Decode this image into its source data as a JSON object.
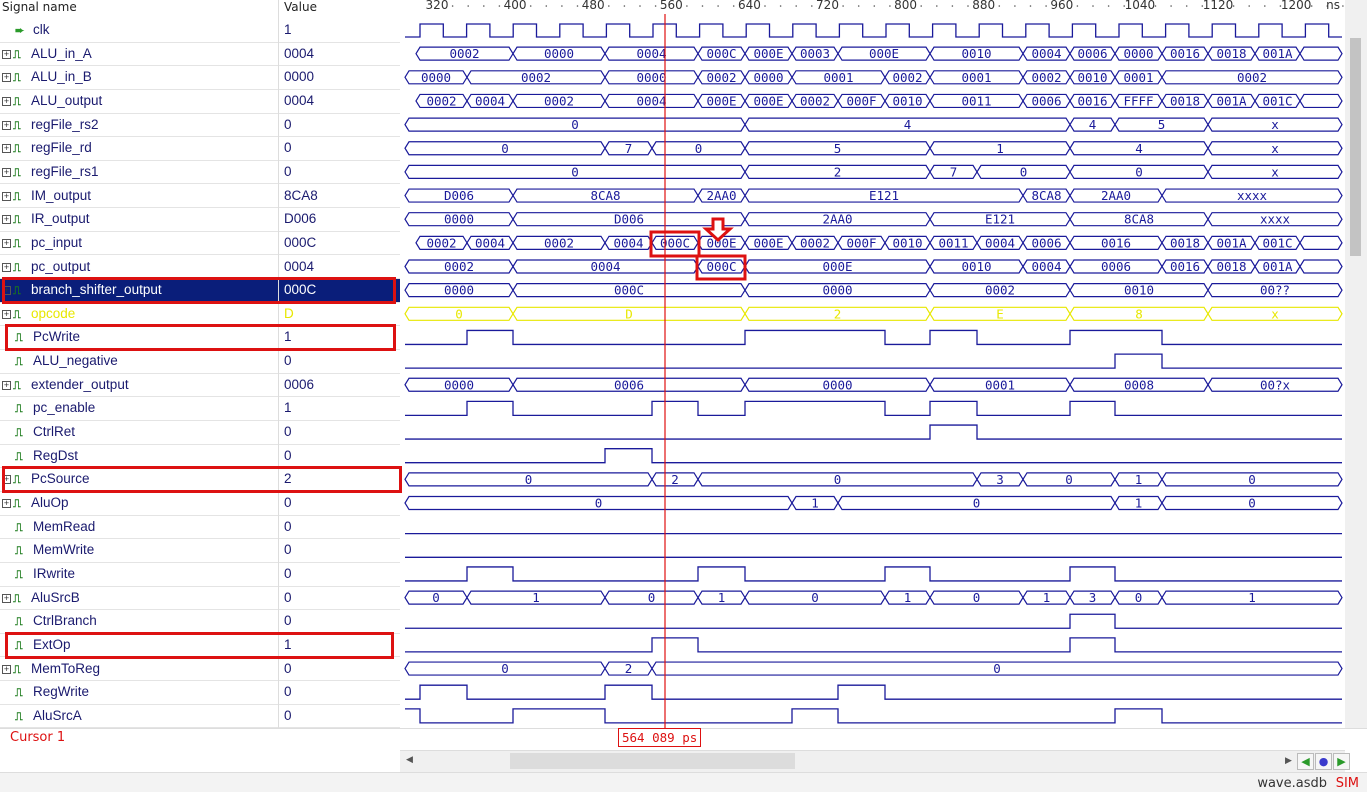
{
  "header": {
    "signal_name": "Signal name",
    "value": "Value",
    "unit": "ns",
    "ticks": [
      "320",
      "400",
      "480",
      "560",
      "640",
      "720",
      "800",
      "880",
      "960",
      "1040",
      "1120",
      "1200"
    ]
  },
  "signals": [
    {
      "name": "clk",
      "value": "1",
      "expand": false,
      "icon": "clock-arrow-icon"
    },
    {
      "name": "ALU_in_A",
      "value": "0004",
      "expand": true
    },
    {
      "name": "ALU_in_B",
      "value": "0000",
      "expand": true
    },
    {
      "name": "ALU_output",
      "value": "0004",
      "expand": true
    },
    {
      "name": "regFile_rs2",
      "value": "0",
      "expand": true
    },
    {
      "name": "regFile_rd",
      "value": "0",
      "expand": true
    },
    {
      "name": "regFile_rs1",
      "value": "0",
      "expand": true
    },
    {
      "name": "IM_output",
      "value": "8CA8",
      "expand": true
    },
    {
      "name": "IR_output",
      "value": "D006",
      "expand": true
    },
    {
      "name": "pc_input",
      "value": "000C",
      "expand": true
    },
    {
      "name": "pc_output",
      "value": "0004",
      "expand": true
    },
    {
      "name": "branch_shifter_output",
      "value": "000C",
      "expand": true,
      "selected": true
    },
    {
      "name": "opcode",
      "value": "D",
      "expand": true,
      "yellow": true
    },
    {
      "name": "PcWrite",
      "value": "1",
      "expand": false
    },
    {
      "name": "ALU_negative",
      "value": "0",
      "expand": false
    },
    {
      "name": "extender_output",
      "value": "0006",
      "expand": true
    },
    {
      "name": "pc_enable",
      "value": "1",
      "expand": false
    },
    {
      "name": "CtrlRet",
      "value": "0",
      "expand": false
    },
    {
      "name": "RegDst",
      "value": "0",
      "expand": false
    },
    {
      "name": "PcSource",
      "value": "2",
      "expand": true
    },
    {
      "name": "AluOp",
      "value": "0",
      "expand": true
    },
    {
      "name": "MemRead",
      "value": "0",
      "expand": false
    },
    {
      "name": "MemWrite",
      "value": "0",
      "expand": false
    },
    {
      "name": "IRwrite",
      "value": "0",
      "expand": false
    },
    {
      "name": "AluSrcB",
      "value": "0",
      "expand": true
    },
    {
      "name": "CtrlBranch",
      "value": "0",
      "expand": false
    },
    {
      "name": "ExtOp",
      "value": "1",
      "expand": false
    },
    {
      "name": "MemToReg",
      "value": "0",
      "expand": true
    },
    {
      "name": "RegWrite",
      "value": "0",
      "expand": false
    },
    {
      "name": "AluSrcA",
      "value": "0",
      "expand": false
    }
  ],
  "waves": {
    "ALU_in_A": [
      [
        "0002",
        416,
        513
      ],
      [
        "0000",
        513,
        605
      ],
      [
        "0004",
        605,
        698
      ],
      [
        "000C",
        698,
        745
      ],
      [
        "000E",
        745,
        792
      ],
      [
        "0003",
        792,
        838
      ],
      [
        "000E",
        838,
        930
      ],
      [
        "0010",
        930,
        1023
      ],
      [
        "0004",
        1023,
        1070
      ],
      [
        "0006",
        1070,
        1115
      ],
      [
        "0000",
        1115,
        1162
      ],
      [
        "0016",
        1162,
        1208
      ],
      [
        "0018",
        1208,
        1255
      ],
      [
        "001A",
        1255,
        1300
      ],
      [
        "",
        1300,
        1342
      ]
    ],
    "ALU_in_B": [
      [
        "0000",
        405,
        467
      ],
      [
        "0002",
        467,
        605
      ],
      [
        "0000",
        605,
        698
      ],
      [
        "0002",
        698,
        745
      ],
      [
        "0000",
        745,
        792
      ],
      [
        "0001",
        792,
        885
      ],
      [
        "0002",
        885,
        930
      ],
      [
        "0001",
        930,
        1023
      ],
      [
        "0002",
        1023,
        1070
      ],
      [
        "0010",
        1070,
        1115
      ],
      [
        "0001",
        1115,
        1162
      ],
      [
        "0002",
        1162,
        1342
      ]
    ],
    "ALU_output": [
      [
        "0002",
        416,
        467
      ],
      [
        "0004",
        467,
        513
      ],
      [
        "0002",
        513,
        605
      ],
      [
        "0004",
        605,
        698
      ],
      [
        "000E",
        698,
        745
      ],
      [
        "000E",
        745,
        792
      ],
      [
        "0002",
        792,
        838
      ],
      [
        "000F",
        838,
        885
      ],
      [
        "0010",
        885,
        930
      ],
      [
        "0011",
        930,
        1023
      ],
      [
        "0006",
        1023,
        1070
      ],
      [
        "0016",
        1070,
        1115
      ],
      [
        "FFFF",
        1115,
        1162
      ],
      [
        "0018",
        1162,
        1208
      ],
      [
        "001A",
        1208,
        1255
      ],
      [
        "001C",
        1255,
        1300
      ],
      [
        "",
        1300,
        1342
      ]
    ],
    "regFile_rs2": [
      [
        "0",
        405,
        745
      ],
      [
        "4",
        745,
        1070
      ],
      [
        "4",
        1070,
        1115
      ],
      [
        "5",
        1115,
        1208
      ],
      [
        "x",
        1208,
        1342
      ]
    ],
    "regFile_rd": [
      [
        "0",
        405,
        605
      ],
      [
        "7",
        605,
        652
      ],
      [
        "0",
        652,
        745
      ],
      [
        "5",
        745,
        930
      ],
      [
        "1",
        930,
        1070
      ],
      [
        "4",
        1070,
        1208
      ],
      [
        "x",
        1208,
        1342
      ]
    ],
    "regFile_rs1": [
      [
        "0",
        405,
        745
      ],
      [
        "2",
        745,
        930
      ],
      [
        "7",
        930,
        977
      ],
      [
        "0",
        977,
        1070
      ],
      [
        "0",
        1070,
        1208
      ],
      [
        "x",
        1208,
        1342
      ]
    ],
    "IM_output": [
      [
        "D006",
        405,
        513
      ],
      [
        "8CA8",
        513,
        698
      ],
      [
        "2AA0",
        698,
        745
      ],
      [
        "E121",
        745,
        1023
      ],
      [
        "8CA8",
        1023,
        1070
      ],
      [
        "2AA0",
        1070,
        1162
      ],
      [
        "xxxx",
        1162,
        1342
      ]
    ],
    "IR_output": [
      [
        "0000",
        405,
        513
      ],
      [
        "D006",
        513,
        745
      ],
      [
        "2AA0",
        745,
        930
      ],
      [
        "E121",
        930,
        1070
      ],
      [
        "8CA8",
        1070,
        1208
      ],
      [
        "xxxx",
        1208,
        1342
      ]
    ],
    "pc_input": [
      [
        "0002",
        416,
        467
      ],
      [
        "0004",
        467,
        513
      ],
      [
        "0002",
        513,
        605
      ],
      [
        "0004",
        605,
        652
      ],
      [
        "000C",
        652,
        698
      ],
      [
        "000E",
        698,
        745
      ],
      [
        "000E",
        745,
        792
      ],
      [
        "0002",
        792,
        838
      ],
      [
        "000F",
        838,
        885
      ],
      [
        "0010",
        885,
        930
      ],
      [
        "0011",
        930,
        977
      ],
      [
        "0004",
        977,
        1023
      ],
      [
        "0006",
        1023,
        1070
      ],
      [
        "0016",
        1070,
        1162
      ],
      [
        "0018",
        1162,
        1208
      ],
      [
        "001A",
        1208,
        1255
      ],
      [
        "001C",
        1255,
        1300
      ],
      [
        "",
        1300,
        1342
      ]
    ],
    "pc_output": [
      [
        "0002",
        405,
        513
      ],
      [
        "0004",
        513,
        698
      ],
      [
        "000C",
        698,
        745
      ],
      [
        "000E",
        745,
        930
      ],
      [
        "0010",
        930,
        1023
      ],
      [
        "0004",
        1023,
        1070
      ],
      [
        "0006",
        1070,
        1162
      ],
      [
        "0016",
        1162,
        1208
      ],
      [
        "0018",
        1208,
        1255
      ],
      [
        "001A",
        1255,
        1300
      ],
      [
        "",
        1300,
        1342
      ]
    ],
    "branch_shifter_output": [
      [
        "0000",
        405,
        513
      ],
      [
        "000C",
        513,
        745
      ],
      [
        "0000",
        745,
        930
      ],
      [
        "0002",
        930,
        1070
      ],
      [
        "0010",
        1070,
        1208
      ],
      [
        "00??",
        1208,
        1342
      ]
    ],
    "opcode": [
      [
        "0",
        405,
        513
      ],
      [
        "D",
        513,
        745
      ],
      [
        "2",
        745,
        930
      ],
      [
        "E",
        930,
        1070
      ],
      [
        "8",
        1070,
        1208
      ],
      [
        "x",
        1208,
        1342
      ]
    ],
    "extender_output": [
      [
        "0000",
        405,
        513
      ],
      [
        "0006",
        513,
        745
      ],
      [
        "0000",
        745,
        930
      ],
      [
        "0001",
        930,
        1070
      ],
      [
        "0008",
        1070,
        1208
      ],
      [
        "00?x",
        1208,
        1342
      ]
    ],
    "PcSource": [
      [
        "0",
        405,
        652
      ],
      [
        "2",
        652,
        698
      ],
      [
        "0",
        698,
        977
      ],
      [
        "3",
        977,
        1023
      ],
      [
        "0",
        1023,
        1115
      ],
      [
        "1",
        1115,
        1162
      ],
      [
        "0",
        1162,
        1342
      ]
    ],
    "AluOp": [
      [
        "0",
        405,
        792
      ],
      [
        "1",
        792,
        838
      ],
      [
        "0",
        838,
        1115
      ],
      [
        "1",
        1115,
        1162
      ],
      [
        "0",
        1162,
        1342
      ]
    ],
    "AluSrcB": [
      [
        "0",
        405,
        467
      ],
      [
        "1",
        467,
        605
      ],
      [
        "0",
        605,
        698
      ],
      [
        "1",
        698,
        745
      ],
      [
        "0",
        745,
        885
      ],
      [
        "1",
        885,
        930
      ],
      [
        "0",
        930,
        1023
      ],
      [
        "1",
        1023,
        1070
      ],
      [
        "3",
        1070,
        1115
      ],
      [
        "0",
        1115,
        1162
      ],
      [
        "1",
        1162,
        1342
      ]
    ],
    "MemToReg": [
      [
        "0",
        405,
        605
      ],
      [
        "2",
        605,
        652
      ],
      [
        "0",
        652,
        1342
      ]
    ]
  },
  "digital": {
    "PcWrite": [
      [
        405,
        467,
        0
      ],
      [
        467,
        513,
        1
      ],
      [
        513,
        745,
        0
      ],
      [
        745,
        885,
        1
      ],
      [
        885,
        930,
        0
      ],
      [
        930,
        977,
        1
      ],
      [
        977,
        1070,
        0
      ],
      [
        1070,
        1162,
        1
      ],
      [
        1162,
        1342,
        0
      ]
    ],
    "ALU_negative": [
      [
        405,
        1115,
        0
      ],
      [
        1115,
        1162,
        1
      ],
      [
        1162,
        1342,
        0
      ]
    ],
    "pc_enable": [
      [
        405,
        467,
        0
      ],
      [
        467,
        513,
        1
      ],
      [
        513,
        652,
        0
      ],
      [
        652,
        698,
        1
      ],
      [
        698,
        745,
        0
      ],
      [
        745,
        885,
        1
      ],
      [
        885,
        930,
        0
      ],
      [
        930,
        977,
        1
      ],
      [
        977,
        1070,
        0
      ],
      [
        1070,
        1115,
        1
      ],
      [
        1115,
        1342,
        0
      ]
    ],
    "CtrlRet": [
      [
        405,
        930,
        0
      ],
      [
        930,
        977,
        1
      ],
      [
        977,
        1342,
        0
      ]
    ],
    "RegDst": [
      [
        405,
        605,
        0
      ],
      [
        605,
        652,
        1
      ],
      [
        652,
        1342,
        0
      ]
    ],
    "MemRead": [
      [
        405,
        1342,
        0
      ]
    ],
    "MemWrite": [
      [
        405,
        1342,
        0
      ]
    ],
    "IRwrite": [
      [
        405,
        467,
        0
      ],
      [
        467,
        513,
        1
      ],
      [
        513,
        698,
        0
      ],
      [
        698,
        745,
        1
      ],
      [
        745,
        885,
        0
      ],
      [
        885,
        930,
        1
      ],
      [
        930,
        1070,
        0
      ],
      [
        1070,
        1115,
        1
      ],
      [
        1115,
        1342,
        0
      ]
    ],
    "CtrlBranch": [
      [
        405,
        1070,
        0
      ],
      [
        1070,
        1115,
        1
      ],
      [
        1115,
        1342,
        0
      ]
    ],
    "ExtOp": [
      [
        405,
        652,
        0
      ],
      [
        652,
        698,
        1
      ],
      [
        698,
        1070,
        0
      ],
      [
        1070,
        1115,
        1
      ],
      [
        1115,
        1342,
        0
      ]
    ],
    "RegWrite": [
      [
        405,
        420,
        0
      ],
      [
        420,
        467,
        1
      ],
      [
        467,
        605,
        0
      ],
      [
        605,
        652,
        1
      ],
      [
        652,
        838,
        0
      ],
      [
        838,
        885,
        1
      ],
      [
        885,
        1342,
        0
      ]
    ],
    "AluSrcA": [
      [
        405,
        420,
        1
      ],
      [
        420,
        513,
        0
      ],
      [
        513,
        605,
        1
      ],
      [
        605,
        792,
        0
      ],
      [
        792,
        838,
        1
      ],
      [
        838,
        1115,
        0
      ],
      [
        1115,
        1162,
        1
      ],
      [
        1162,
        1342,
        0
      ]
    ]
  },
  "cursor": {
    "label": "Cursor 1",
    "time": "564 089 ps"
  },
  "status": {
    "file": "wave.asdb",
    "mode": "SIM"
  },
  "colors": {
    "wave": "#1a1a9a",
    "cursor": "#e01010",
    "highlight": "#dd1111",
    "selected_row": "#0a1e7a",
    "yellow": "#e8e800"
  }
}
